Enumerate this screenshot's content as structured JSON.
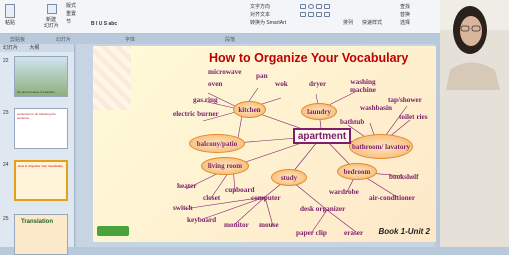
{
  "ribbon": {
    "paste": "粘贴",
    "new_slide": "新建",
    "new_slide2": "幻灯片",
    "layout": "版式",
    "reset": "重置",
    "section": "节",
    "groups": [
      "剪贴板",
      "幻灯片",
      "字体",
      "段落"
    ],
    "text_direction": "文字方向",
    "align_text": "对齐文本",
    "convert_smartart": "转换为 SmartArt",
    "arrange": "排列",
    "quick_styles": "快速样式",
    "find": "查找",
    "replace": "替换",
    "select": "选择"
  },
  "sidebar": {
    "tabs": [
      "幻灯片",
      "大纲"
    ],
    "thumbs": [
      {
        "num": "22",
        "text": "My dream house is beautiful"
      },
      {
        "num": "23",
        "text": "sentences to do following the sentence"
      },
      {
        "num": "24",
        "text": "How to Organize Your Vocabulary"
      },
      {
        "num": "25",
        "text": "Translation"
      }
    ]
  },
  "slide": {
    "title": "How to Organize Your Vocabulary",
    "center": "apartment",
    "nodes": [
      "kitchen",
      "laundry",
      "balcony/patio",
      "bathroom/ lavatory",
      "living room",
      "study",
      "bedroom"
    ],
    "words": [
      "microwave",
      "pan",
      "oven",
      "wok",
      "gas ring",
      "electric burner",
      "dryer",
      "washing machine",
      "tap/shower",
      "washbasin",
      "toilet ries",
      "bathtub",
      "heater",
      "closet",
      "cupboard",
      "computer",
      "switch",
      "keyboard",
      "monitor",
      "mouse",
      "desk organizer",
      "paper clip",
      "eraser",
      "wardrobe",
      "bookshelf",
      "air-conditioner"
    ],
    "footer": "Book 1-Unit 2"
  }
}
